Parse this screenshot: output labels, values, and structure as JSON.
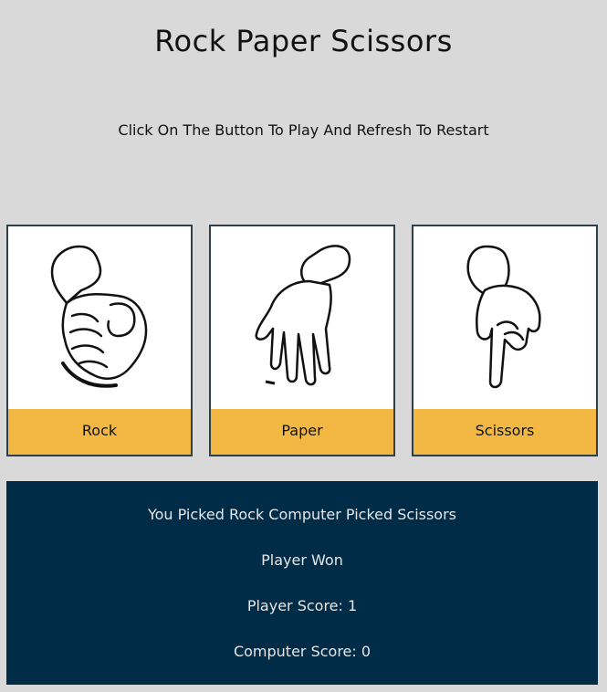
{
  "page": {
    "title": "Rock Paper Scissors",
    "instructions": "Click On The Button To Play And Refresh To Restart"
  },
  "choices": [
    {
      "label": "Rock",
      "icon": "rock-hand-icon"
    },
    {
      "label": "Paper",
      "icon": "paper-hand-icon"
    },
    {
      "label": "Scissors",
      "icon": "scissors-hand-icon"
    }
  ],
  "results": {
    "picks": "You Picked Rock Computer Picked Scissors",
    "outcome": "Player Won",
    "player_score": "Player Score: 1",
    "computer_score": "Computer Score: 0"
  },
  "colors": {
    "background": "#d9d9d9",
    "label_bar": "#f2b843",
    "results_panel": "#002c48",
    "card_border": "#2f3f48"
  }
}
